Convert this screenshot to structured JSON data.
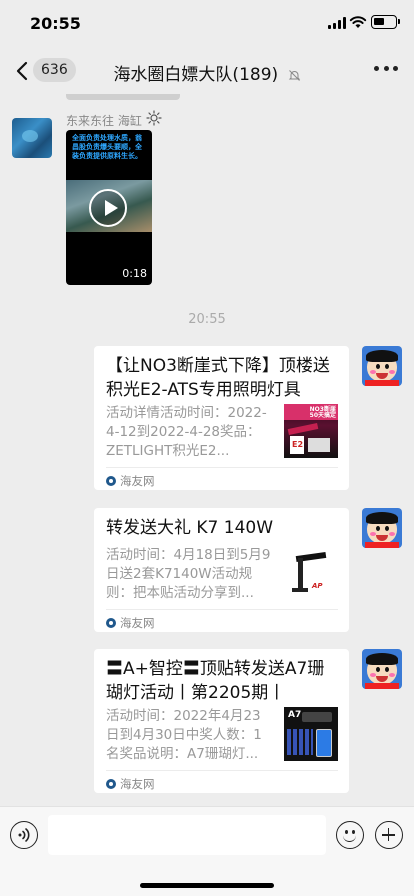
{
  "status_bar": {
    "time": "20:55"
  },
  "nav": {
    "unread_count": "636",
    "title": "海水圈白嫖大队(189)"
  },
  "incoming": {
    "sender": "东来东往 海缸",
    "video": {
      "caption": "全面负责处理水质，翁昌股负责爆头要顺，全装负责提供原料生长。",
      "duration": "0:18"
    }
  },
  "time_divider": "20:55",
  "cards": [
    {
      "title": "【让NO3断崖式下降】顶楼送积光E2-ATS专用照明灯具",
      "desc": "活动详情活动时间：2022-4-12到2022-4-28奖品：ZETLIGHT积光E2...",
      "source": "海友网",
      "thumb_text": "NO3断崖\n50天搞定",
      "thumb_label": "E2"
    },
    {
      "title": "转发送大礼 K7 140W",
      "desc": "活动时间：4月18日到5月9日送2套K7140W活动规则：把本贴活动分享到...",
      "source": "海友网",
      "thumb_logo": "AP"
    },
    {
      "title": "〓A+智控〓顶贴转发送A7珊瑚灯活动丨第2205期丨",
      "desc": "活动时间：2022年4月23日到4月30日中奖人数：1名奖品说明：A7珊瑚灯...",
      "source": "海友网",
      "thumb_label": "A7"
    }
  ],
  "colors": {
    "background": "#ededed",
    "card": "#ffffff",
    "muted_text": "#999999",
    "video_caption": "#2ea7ff"
  }
}
